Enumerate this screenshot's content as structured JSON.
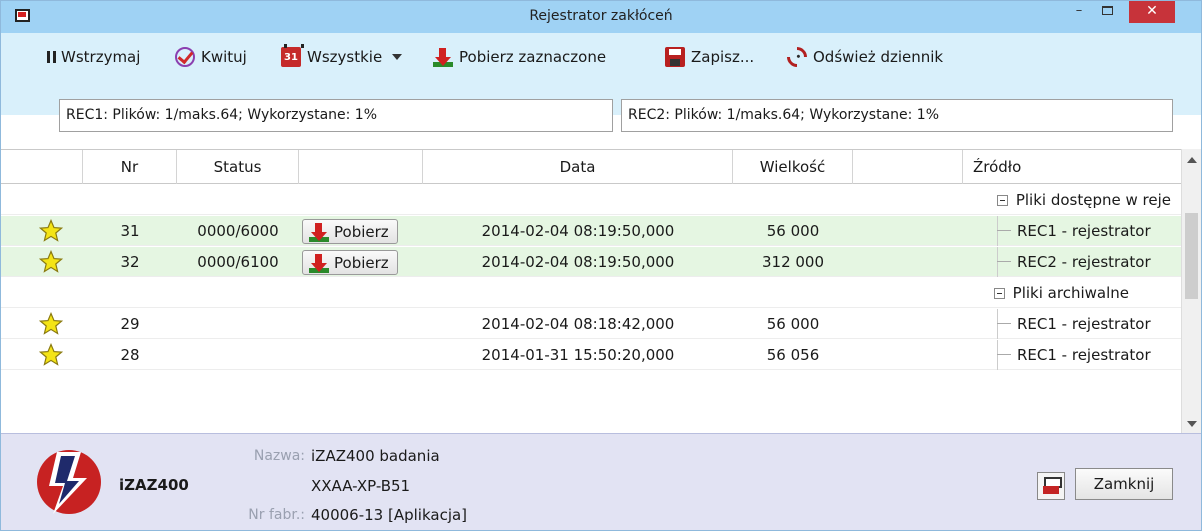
{
  "window": {
    "title": "Rejestrator zakłóceń",
    "minimize_glyph": "–",
    "close_glyph": "✕"
  },
  "toolbar": {
    "pause_label": "Wstrzymaj",
    "ack_label": "Kwituj",
    "all_label": "Wszystkie",
    "calendar_day": "31",
    "download_selected_label": "Pobierz zaznaczone",
    "save_label": "Zapisz...",
    "refresh_label": "Odśwież dziennik"
  },
  "recorders": {
    "rec1": "REC1: Plików: 1/maks.64; Wykorzystane: 1%",
    "rec2": "REC2: Plików: 1/maks.64; Wykorzystane: 1%"
  },
  "grid": {
    "columns": [
      "Nr",
      "Status",
      "Data",
      "Wielkość",
      "Źródło"
    ],
    "groups": [
      {
        "label": "Pliki dostępne w reje",
        "rows": [
          {
            "nr": "31",
            "status": "0000/6000",
            "button": "Pobierz",
            "data": "2014-02-04 08:19:50,000",
            "size": "56 000",
            "source": "REC1 - rejestrator"
          },
          {
            "nr": "32",
            "status": "0000/6100",
            "button": "Pobierz",
            "data": "2014-02-04 08:19:50,000",
            "size": "312 000",
            "source": "REC2 - rejestrator"
          }
        ]
      },
      {
        "label": "Pliki archiwalne",
        "rows": [
          {
            "nr": "29",
            "status": "",
            "data": "2014-02-04 08:18:42,000",
            "size": "56 000",
            "source": "REC1 - rejestrator"
          },
          {
            "nr": "28",
            "status": "",
            "data": "2014-01-31 15:50:20,000",
            "size": "56 056",
            "source": "REC1 - rejestrator"
          }
        ]
      }
    ]
  },
  "footer": {
    "device": "iZAZ400",
    "name_label": "Nazwa:",
    "name_value": "iZAZ400 badania",
    "code_value": "XXAA-XP-B51",
    "serial_label": "Nr fabr.:",
    "serial_value": "40006-13 [Aplikacja]",
    "close_label": "Zamknij"
  },
  "colors": {
    "titlebar": "#9fd2f4",
    "toolbar": "#d9f0fb",
    "row_available": "#e5f6e2",
    "footer": "#e2e3f3",
    "accent_red": "#d02020"
  }
}
